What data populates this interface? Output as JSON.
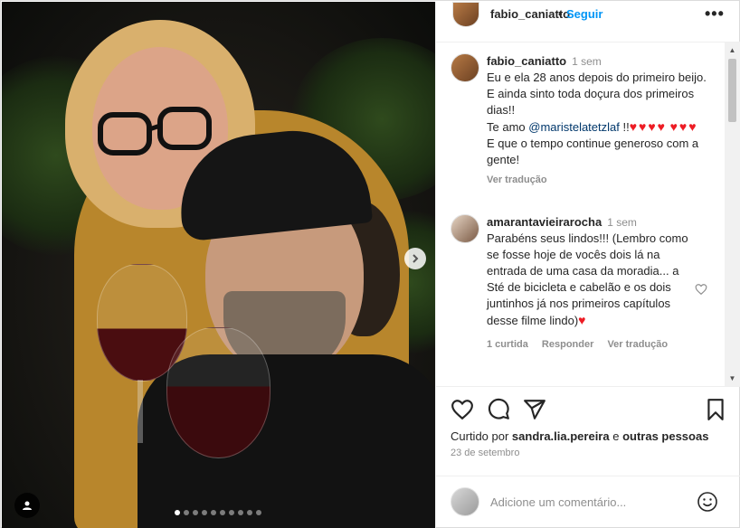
{
  "post": {
    "author": "fabio_caniatto",
    "separator": "•",
    "follow_label": "Seguir",
    "more_label": "•••"
  },
  "caption": {
    "username": "fabio_caniatto",
    "time": "1 sem",
    "line1": "Eu e ela 28 anos depois do primeiro beijo. E ainda sinto toda doçura dos primeiros dias!!",
    "line2_prefix": "Te amo ",
    "mention": "@maristelatetzlaf",
    "line2_suffix": " !!",
    "hearts_a": "♥♥♥♥",
    "hearts_b": "♥♥♥",
    "line3": "E que o tempo continue generoso com a gente!",
    "translate": "Ver tradução"
  },
  "comment": {
    "username": "amarantavieirarocha",
    "time": "1 sem",
    "text": "Parabéns seus lindos!!! (Lembro como se fosse hoje de vocês dois lá na entrada de uma casa da moradia... a Sté de bicicleta e cabelão e os dois juntinhos já nos primeiros capítulos desse filme lindo)",
    "heart": "♥",
    "likes": "1 curtida",
    "reply": "Responder",
    "translate": "Ver tradução"
  },
  "likes": {
    "prefix": "Curtido por ",
    "user": "sandra.lia.pereira",
    "middle": " e ",
    "others": "outras pessoas"
  },
  "date": "23 de setembro",
  "add_comment": {
    "placeholder": "Adicione um comentário..."
  },
  "carousel": {
    "total": 10,
    "active_index": 0
  },
  "colors": {
    "link": "#0095f6",
    "heart": "#ed1c24",
    "muted": "#8e8e8e",
    "mention": "#00376b"
  }
}
